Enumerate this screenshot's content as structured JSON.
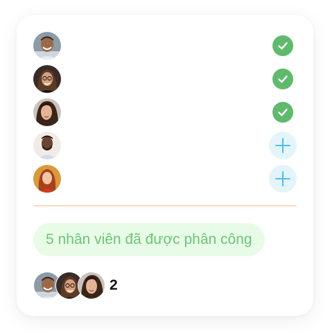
{
  "assignees": [
    {
      "name_icon": "avatar-man-smiling",
      "status": "assigned"
    },
    {
      "name_icon": "avatar-woman-glasses",
      "status": "assigned"
    },
    {
      "name_icon": "avatar-woman-dark-hair",
      "status": "assigned"
    },
    {
      "name_icon": "avatar-man-beard",
      "status": "not-assigned"
    },
    {
      "name_icon": "avatar-woman-red-hair",
      "status": "not-assigned"
    }
  ],
  "summary": {
    "assigned_text": "5 nhân viên đã được phân công",
    "extra_count": "2"
  },
  "colors": {
    "check": "#5fba6d",
    "add_bg": "#e4f4fb",
    "add_icon": "#3fb6e3",
    "divider": "#f8dcc4",
    "pill_bg": "#e8fbe6",
    "pill_text": "#6cc477"
  }
}
